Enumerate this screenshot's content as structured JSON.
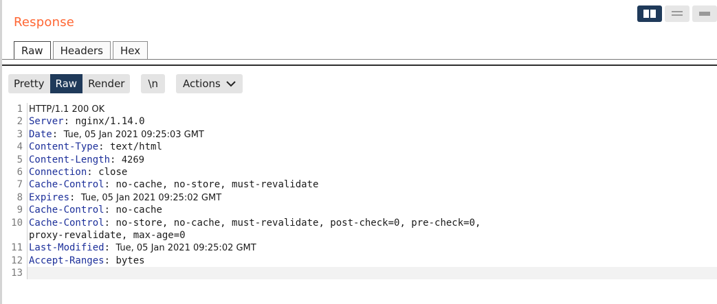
{
  "panel": {
    "title": "Response"
  },
  "view_tabs": [
    "Raw",
    "Headers",
    "Hex"
  ],
  "toolbar": {
    "pretty_label": "Pretty",
    "raw_label": "Raw",
    "render_label": "Render",
    "newline_label": "\\n",
    "actions_label": "Actions"
  },
  "colors": {
    "title": "#ff6633",
    "accent": "#1f3a5a",
    "header_key": "#1c2f9a"
  },
  "lines": [
    {
      "num": "1",
      "status": "HTTP/1.1 200 OK"
    },
    {
      "num": "2",
      "key": "Server",
      "sep": ": ",
      "value": "nginx/1.14.0"
    },
    {
      "num": "3",
      "key": "Date",
      "sep": ": ",
      "value": "Tue, 05 Jan 2021 09:25:03 GMT"
    },
    {
      "num": "4",
      "key": "Content-Type",
      "sep": ": ",
      "value": "text/html"
    },
    {
      "num": "5",
      "key": "Content-Length",
      "sep": ": ",
      "value": "4269"
    },
    {
      "num": "6",
      "key": "Connection",
      "sep": ": ",
      "value": "close"
    },
    {
      "num": "7",
      "key": "Cache-Control",
      "sep": ": ",
      "value": "no-cache, no-store, must-revalidate"
    },
    {
      "num": "8",
      "key": "Expires",
      "sep": ": ",
      "value": "Tue, 05 Jan 2021 09:25:02 GMT"
    },
    {
      "num": "9",
      "key": "Cache-Control",
      "sep": ": ",
      "value": "no-cache"
    },
    {
      "num": "10",
      "key": "Cache-Control",
      "sep": ": ",
      "value": "no-store, no-cache, must-revalidate, post-check=0, pre-check=0,"
    },
    {
      "num": "",
      "cont": "proxy-revalidate, max-age=0"
    },
    {
      "num": "11",
      "key": "Last-Modified",
      "sep": ": ",
      "value": "Tue, 05 Jan 2021 09:25:02 GMT"
    },
    {
      "num": "12",
      "key": "Accept-Ranges",
      "sep": ": ",
      "value": "bytes"
    },
    {
      "num": "13",
      "blank": true
    }
  ]
}
